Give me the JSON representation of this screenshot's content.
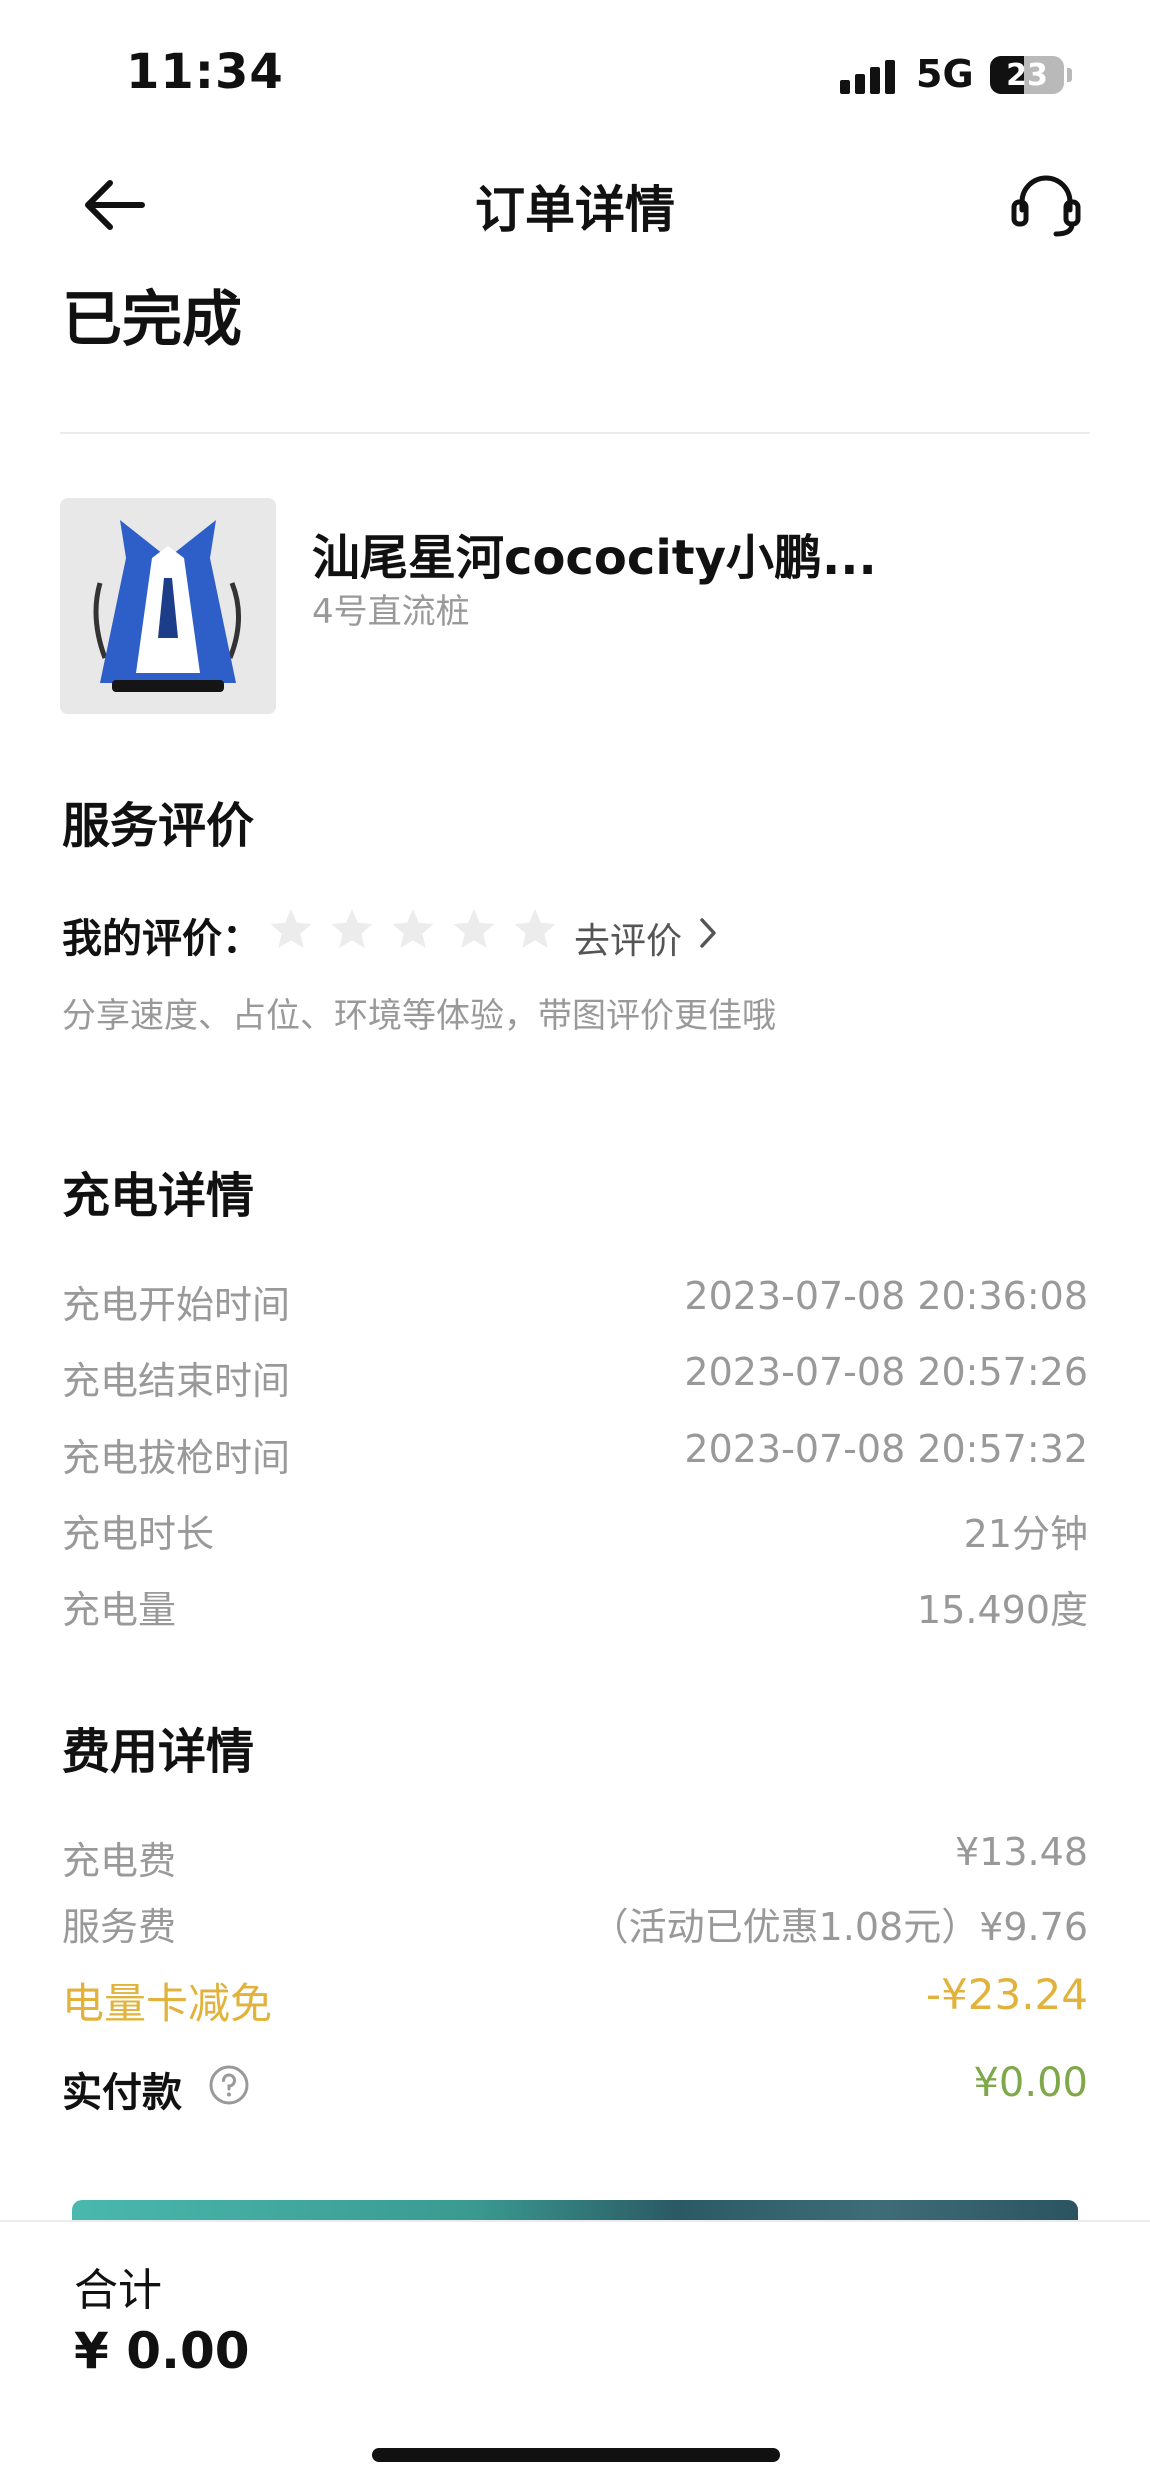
{
  "status_bar": {
    "time": "11:34",
    "network": "5G",
    "battery": "23"
  },
  "nav": {
    "title": "订单详情"
  },
  "order_status": "已完成",
  "station": {
    "name": "汕尾星河cococity小鹏...",
    "pile": "4号直流桩"
  },
  "review": {
    "section_title": "服务评价",
    "label": "我的评价：",
    "stars_filled": 0,
    "stars_total": 5,
    "action": "去评价",
    "hint": "分享速度、占位、环境等体验，带图评价更佳哦"
  },
  "charging": {
    "section_title": "充电详情",
    "rows": [
      {
        "label": "充电开始时间",
        "value": "2023-07-08 20:36:08"
      },
      {
        "label": "充电结束时间",
        "value": "2023-07-08 20:57:26"
      },
      {
        "label": "充电拔枪时间",
        "value": "2023-07-08 20:57:32"
      },
      {
        "label": "充电时长",
        "value": "21分钟"
      },
      {
        "label": "充电量",
        "value": "15.490度"
      }
    ]
  },
  "fees": {
    "section_title": "费用详情",
    "charge_fee": {
      "label": "充电费",
      "value": "¥13.48"
    },
    "service_fee": {
      "label": "服务费",
      "value": "（活动已优惠1.08元）¥9.76"
    },
    "card_discount": {
      "label": "电量卡减免",
      "value": "-¥23.24"
    },
    "paid": {
      "label": "实付款",
      "value": "¥0.00"
    }
  },
  "footer": {
    "total_label": "合计",
    "total_value": "¥ 0.00"
  },
  "colors": {
    "discount": "#e2b33c",
    "paid": "#7ea84a",
    "muted": "#999999"
  }
}
